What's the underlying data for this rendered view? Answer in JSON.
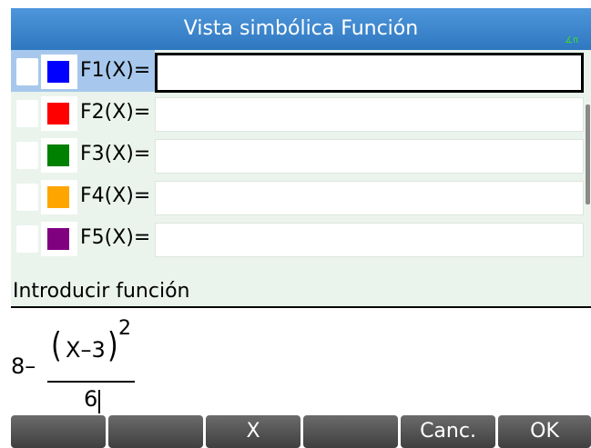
{
  "title": "Vista simbólica Función",
  "status": {
    "angle_indicator": "∡π"
  },
  "functions": [
    {
      "label": "F1(X)=",
      "color": "#0000ff",
      "value": "",
      "selected": true
    },
    {
      "label": "F2(X)=",
      "color": "#ff0000",
      "value": ""
    },
    {
      "label": "F3(X)=",
      "color": "#008000",
      "value": ""
    },
    {
      "label": "F4(X)=",
      "color": "#ffa500",
      "value": ""
    },
    {
      "label": "F5(X)=",
      "color": "#800080",
      "value": ""
    }
  ],
  "prompt": "Introducir función",
  "editline": {
    "prefix": "8–",
    "numerator": "X–3",
    "open_paren": "(",
    "close_paren": ")",
    "exponent": "2",
    "denominator": "6"
  },
  "softkeys": [
    {
      "label": ""
    },
    {
      "label": ""
    },
    {
      "label": "X"
    },
    {
      "label": ""
    },
    {
      "label": "Canc."
    },
    {
      "label": "OK"
    }
  ],
  "colors": {
    "title_bar": "#3e87cd",
    "list_bg": "#eaf4ec",
    "selected_bg": "#a7c8ec",
    "softkey_bg": "#4f4f4f"
  }
}
